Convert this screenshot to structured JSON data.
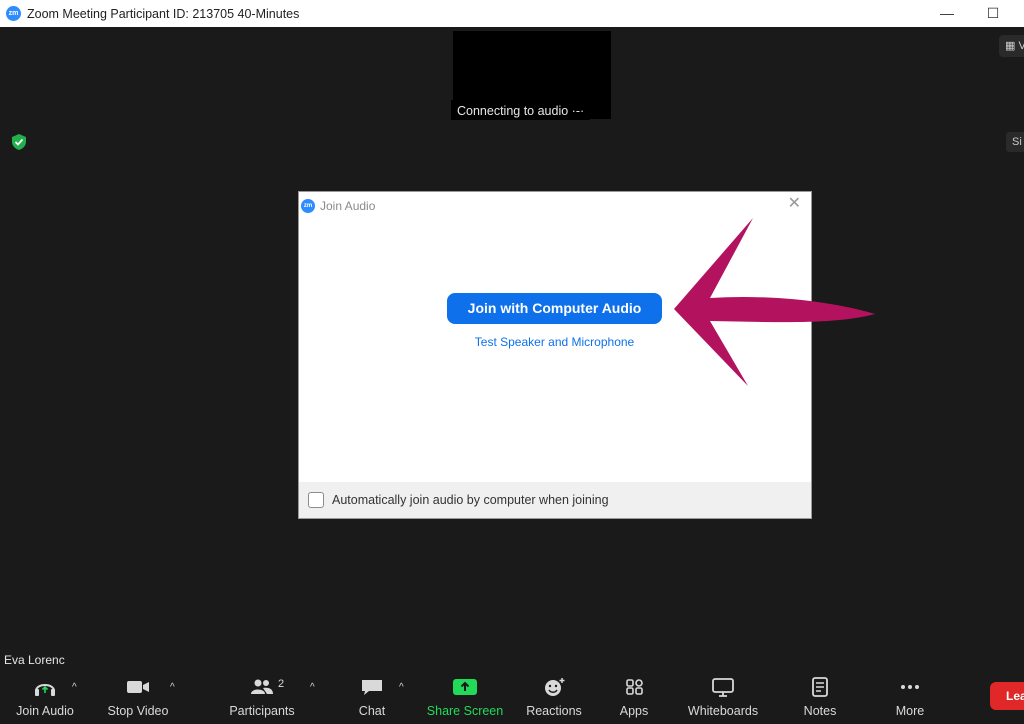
{
  "window": {
    "title": "Zoom Meeting Participant ID: 213705   40-Minutes",
    "logo_text": "zm",
    "minimize_label": "—",
    "maximize_label": "☐"
  },
  "stage": {
    "connecting_text": "Connecting to audio ·-·",
    "view_label": "▦ V",
    "side_label": "Si",
    "participant_name": "Eva Lorenc"
  },
  "dialog": {
    "title": "Join Audio",
    "logo_text": "zm",
    "close_label": "✕",
    "join_button": "Join with Computer Audio",
    "test_link": "Test Speaker and Microphone",
    "auto_join_label": "Automatically join audio by computer when joining"
  },
  "toolbar": {
    "join_audio": "Join Audio",
    "stop_video": "Stop Video",
    "participants": "Participants",
    "participants_count": "2",
    "chat": "Chat",
    "share_screen": "Share Screen",
    "reactions": "Reactions",
    "apps": "Apps",
    "whiteboards": "Whiteboards",
    "notes": "Notes",
    "more": "More",
    "leave": "Leave",
    "caret": "^"
  },
  "icons": {
    "headphones": "headphones-icon",
    "video": "video-camera-icon",
    "participants": "people-icon",
    "chat": "chat-bubble-icon",
    "share": "share-screen-icon",
    "reactions": "smiley-plus-icon",
    "apps": "apps-icon",
    "whiteboards": "whiteboard-icon",
    "notes": "notes-icon",
    "more": "more-dots-icon",
    "shield": "shield-check-icon"
  },
  "colors": {
    "accent_blue": "#0e71eb",
    "share_green": "#23d959",
    "leave_red": "#e02828",
    "annotation_arrow": "#b3135e",
    "background": "#1a1a1a"
  }
}
